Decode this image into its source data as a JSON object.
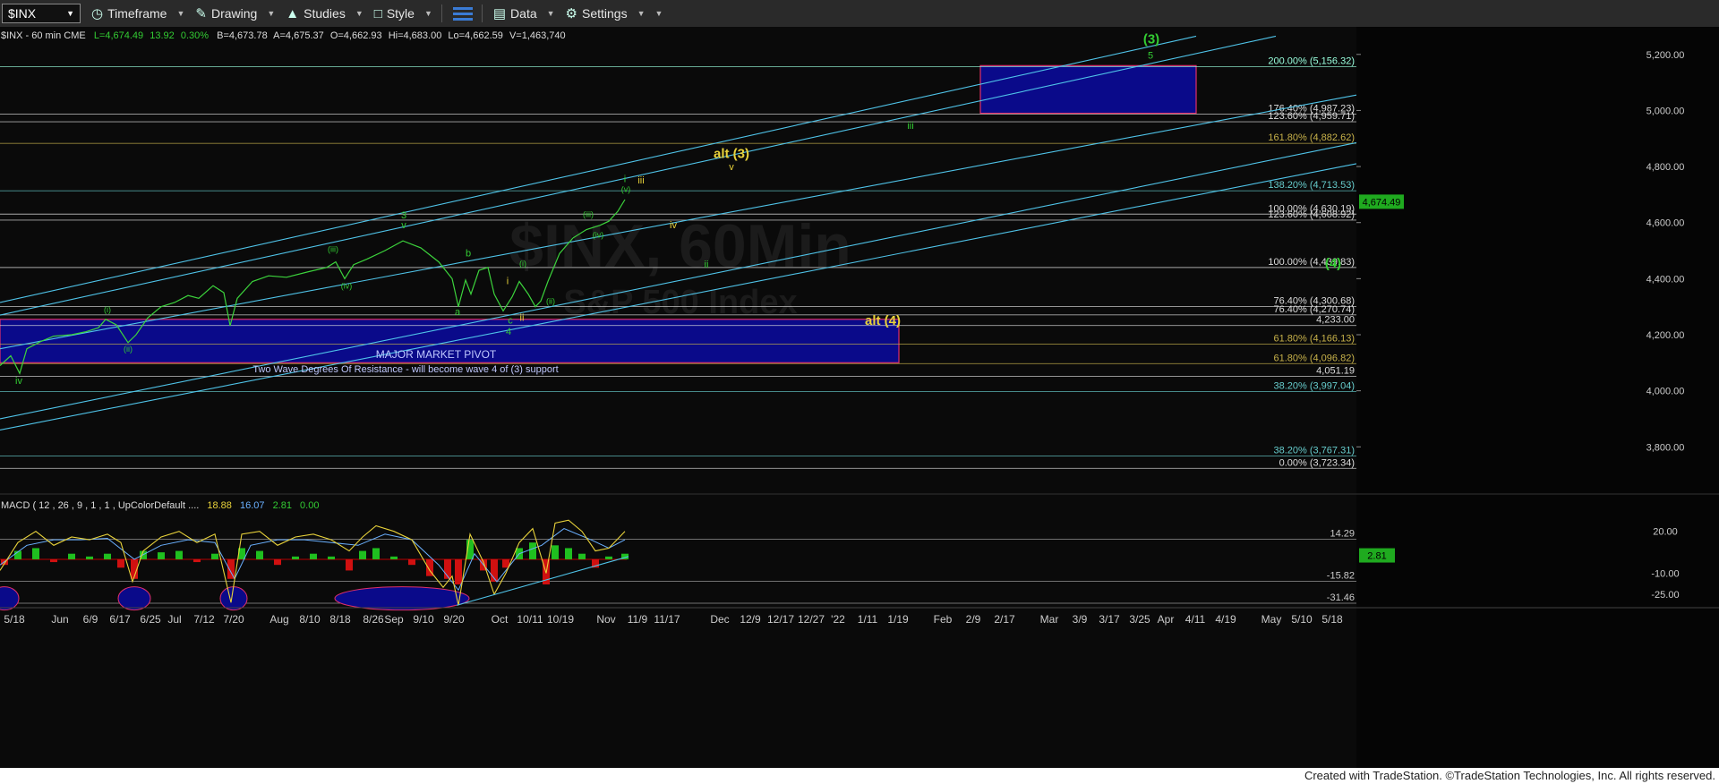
{
  "toolbar": {
    "symbol": "$INX",
    "timeframe": "Timeframe",
    "drawing": "Drawing",
    "studies": "Studies",
    "style": "Style",
    "data": "Data",
    "settings": "Settings"
  },
  "chart_data": {
    "type": "line",
    "header": "$INX - 60 min  CME",
    "quote": {
      "last": "L=4,674.49",
      "change": "13.92",
      "pct": "0.30%",
      "bid": "B=4,673.78",
      "ask": "A=4,675.37",
      "open": "O=4,662.93",
      "high": "Hi=4,683.00",
      "low": "Lo=4,662.59",
      "volume": "V=1,463,740"
    },
    "watermark": "$INX, 60Min",
    "watermark_sub": "S&P 500 Index",
    "price_axis": {
      "ylim": [
        3670,
        5260
      ],
      "ticks": [
        "3,800.00",
        "4,000.00",
        "4,200.00",
        "4,400.00",
        "4,600.00",
        "4,800.00",
        "5,000.00",
        "5,200.00"
      ],
      "last_label": "4,674.49"
    },
    "x_axis_labels": [
      "5/18",
      "Jun",
      "6/9",
      "6/17",
      "6/25",
      "Jul",
      "7/12",
      "7/20",
      "Aug",
      "8/10",
      "8/18",
      "8/26",
      "Sep",
      "9/10",
      "9/20",
      "Oct",
      "10/11",
      "10/19",
      "Nov",
      "11/9",
      "11/17",
      "Dec",
      "12/9",
      "12/17",
      "12/27",
      "'22",
      "1/11",
      "1/19",
      "Feb",
      "2/9",
      "2/17",
      "Mar",
      "3/9",
      "3/17",
      "3/25",
      "Apr",
      "4/11",
      "4/19",
      "May",
      "5/10",
      "5/18"
    ],
    "levels": [
      {
        "price": 5156.32,
        "label": "200.00% (5,156.32)",
        "color": "#9fd"
      },
      {
        "price": 4987.23,
        "label": "176.40% (4,987.23)",
        "color": "#ddd"
      },
      {
        "price": 4959.71,
        "label": "123.60% (4,959.71)",
        "color": "#ddd"
      },
      {
        "price": 4882.62,
        "label": "161.80% (4,882.62)",
        "color": "#c8b24a"
      },
      {
        "price": 4713.53,
        "label": "138.20% (4,713.53)",
        "color": "#6cc"
      },
      {
        "price": 4630.19,
        "label": "100.00% (4,630.19)",
        "color": "#ddd"
      },
      {
        "price": 4608.92,
        "label": "123.60% (4,608.92)",
        "color": "#ddd"
      },
      {
        "price": 4439.83,
        "label": "100.00% (4,439.83)",
        "color": "#ddd"
      },
      {
        "price": 4300.68,
        "label": "76.40% (4,300.68)",
        "color": "#ddd"
      },
      {
        "price": 4270.74,
        "label": "76.40% (4,270.74)",
        "color": "#ddd"
      },
      {
        "price": 4233.0,
        "label": "4,233.00",
        "color": "#ddd"
      },
      {
        "price": 4166.13,
        "label": "61.80% (4,166.13)",
        "color": "#c8b24a"
      },
      {
        "price": 4096.82,
        "label": "61.80% (4,096.82)",
        "color": "#c8b24a"
      },
      {
        "price": 4051.19,
        "label": "4,051.19",
        "color": "#ddd"
      },
      {
        "price": 3997.04,
        "label": "38.20% (3,997.04)",
        "color": "#6cc"
      },
      {
        "price": 3767.31,
        "label": "38.20% (3,767.31)",
        "color": "#6cc"
      },
      {
        "price": 3723.34,
        "label": "0.00% (3,723.34)",
        "color": "#ddd"
      }
    ],
    "zones": [
      {
        "name": "target-zone",
        "x0": 1095,
        "x1": 1336,
        "p0": 4990,
        "p1": 5160,
        "border": "#e0306a"
      },
      {
        "name": "major-pivot-zone",
        "x0": 0,
        "x1": 1004,
        "p0": 4100,
        "p1": 4255,
        "border": "#e0306a"
      }
    ],
    "pivot_title": "MAJOR MARKET PIVOT",
    "pivot_sub": "Two Wave Degrees Of Resistance - will become wave 4 of (3) support",
    "price_path": [
      [
        0,
        4090
      ],
      [
        12,
        4125
      ],
      [
        22,
        4062
      ],
      [
        30,
        4150
      ],
      [
        45,
        4175
      ],
      [
        60,
        4195
      ],
      [
        80,
        4200
      ],
      [
        95,
        4210
      ],
      [
        110,
        4225
      ],
      [
        118,
        4255
      ],
      [
        130,
        4235
      ],
      [
        143,
        4172
      ],
      [
        152,
        4200
      ],
      [
        165,
        4260
      ],
      [
        180,
        4300
      ],
      [
        195,
        4315
      ],
      [
        210,
        4340
      ],
      [
        222,
        4330
      ],
      [
        238,
        4375
      ],
      [
        250,
        4350
      ],
      [
        257,
        4232
      ],
      [
        265,
        4330
      ],
      [
        282,
        4390
      ],
      [
        300,
        4410
      ],
      [
        320,
        4405
      ],
      [
        345,
        4425
      ],
      [
        365,
        4440
      ],
      [
        375,
        4460
      ],
      [
        385,
        4400
      ],
      [
        395,
        4450
      ],
      [
        410,
        4470
      ],
      [
        430,
        4500
      ],
      [
        450,
        4535
      ],
      [
        470,
        4510
      ],
      [
        490,
        4460
      ],
      [
        505,
        4400
      ],
      [
        512,
        4300
      ],
      [
        520,
        4395
      ],
      [
        526,
        4345
      ],
      [
        535,
        4430
      ],
      [
        545,
        4440
      ],
      [
        552,
        4345
      ],
      [
        562,
        4285
      ],
      [
        572,
        4335
      ],
      [
        580,
        4390
      ],
      [
        590,
        4345
      ],
      [
        598,
        4300
      ],
      [
        604,
        4320
      ],
      [
        612,
        4390
      ],
      [
        625,
        4490
      ],
      [
        640,
        4545
      ],
      [
        655,
        4575
      ],
      [
        670,
        4590
      ],
      [
        680,
        4605
      ],
      [
        690,
        4640
      ],
      [
        698,
        4682
      ]
    ],
    "channels": [
      {
        "pts": [
          [
            0,
            4315
          ],
          [
            1336,
            5265
          ]
        ]
      },
      {
        "pts": [
          [
            0,
            4270
          ],
          [
            1425,
            5265
          ]
        ]
      },
      {
        "pts": [
          [
            0,
            4150
          ],
          [
            1515,
            5055
          ]
        ]
      },
      {
        "pts": [
          [
            0,
            3900
          ],
          [
            1515,
            4885
          ]
        ]
      },
      {
        "pts": [
          [
            0,
            3860
          ],
          [
            1515,
            4810
          ]
        ]
      }
    ],
    "wave_labels": [
      {
        "t": "(3)",
        "x": 1286,
        "p": 5240,
        "c": "#3c3",
        "s": 15
      },
      {
        "t": "5",
        "x": 1285,
        "p": 5185,
        "c": "#3c3",
        "s": 11
      },
      {
        "t": "iii",
        "x": 1017,
        "p": 4935,
        "c": "#3c3",
        "s": 11
      },
      {
        "t": "alt (3)",
        "x": 817,
        "p": 4830,
        "c": "#e8d23a",
        "s": 15
      },
      {
        "t": "v",
        "x": 817,
        "p": 4788,
        "c": "#e8d23a",
        "s": 11
      },
      {
        "t": "iv",
        "x": 752,
        "p": 4580,
        "c": "#e8d23a",
        "s": 11
      },
      {
        "t": "ii",
        "x": 789,
        "p": 4440,
        "c": "#3c3",
        "s": 11
      },
      {
        "t": "(4)",
        "x": 1489,
        "p": 4440,
        "c": "#3c3",
        "s": 15
      },
      {
        "t": "alt (4)",
        "x": 986,
        "p": 4235,
        "c": "#e8d23a",
        "s": 15
      },
      {
        "t": "i",
        "x": 698,
        "p": 4745,
        "c": "#3c3",
        "s": 11
      },
      {
        "t": "iii",
        "x": 716,
        "p": 4740,
        "c": "#e8d23a",
        "s": 11
      },
      {
        "t": "(v)",
        "x": 699,
        "p": 4710,
        "c": "#3c3",
        "s": 9
      },
      {
        "t": "(iii)",
        "x": 657,
        "p": 4620,
        "c": "#3c3",
        "s": 9
      },
      {
        "t": "(iv)",
        "x": 668,
        "p": 4547,
        "c": "#3c3",
        "s": 9
      },
      {
        "t": "3",
        "x": 451,
        "p": 4615,
        "c": "#3c3",
        "s": 11
      },
      {
        "t": "v",
        "x": 451,
        "p": 4580,
        "c": "#3c3",
        "s": 11
      },
      {
        "t": "(iii)",
        "x": 372,
        "p": 4495,
        "c": "#3c3",
        "s": 9
      },
      {
        "t": "(iv)",
        "x": 387,
        "p": 4365,
        "c": "#3c3",
        "s": 9
      },
      {
        "t": "b",
        "x": 523,
        "p": 4480,
        "c": "#3c3",
        "s": 11
      },
      {
        "t": "a",
        "x": 511,
        "p": 4270,
        "c": "#3c3",
        "s": 11
      },
      {
        "t": "(i)",
        "x": 584,
        "p": 4445,
        "c": "#3c3",
        "s": 9
      },
      {
        "t": "i",
        "x": 567,
        "p": 4380,
        "c": "#e8d23a",
        "s": 11
      },
      {
        "t": "c",
        "x": 570,
        "p": 4240,
        "c": "#3c3",
        "s": 11
      },
      {
        "t": "4",
        "x": 568,
        "p": 4200,
        "c": "#3c3",
        "s": 11
      },
      {
        "t": "ii",
        "x": 583,
        "p": 4250,
        "c": "#e8d23a",
        "s": 11
      },
      {
        "t": "(ii)",
        "x": 615,
        "p": 4310,
        "c": "#3c3",
        "s": 9
      },
      {
        "t": "(i)",
        "x": 120,
        "p": 4280,
        "c": "#3c3",
        "s": 9
      },
      {
        "t": "(ii)",
        "x": 143,
        "p": 4140,
        "c": "#3c3",
        "s": 9
      },
      {
        "t": "iv",
        "x": 21,
        "p": 4025,
        "c": "#3c3",
        "s": 11
      }
    ],
    "macd": {
      "label": "MACD ( 12 , 26 , 9 , 1 , 1 , UpColorDefault ....",
      "v1": "18.88",
      "v2": "16.07",
      "v3": "2.81",
      "v4": "0.00",
      "ylim": [
        -34,
        32
      ],
      "axis": [
        "20.00",
        "-10.00",
        "-25.00"
      ],
      "levels": [
        {
          "v": 14.29,
          "label": "14.29"
        },
        {
          "v": -15.82,
          "label": "-15.82"
        },
        {
          "v": -31.46,
          "label": "-31.46"
        }
      ],
      "last": "2.81",
      "macd_line": [
        [
          0,
          -8
        ],
        [
          20,
          12
        ],
        [
          40,
          20
        ],
        [
          60,
          10
        ],
        [
          80,
          16
        ],
        [
          100,
          14
        ],
        [
          120,
          18
        ],
        [
          135,
          12
        ],
        [
          148,
          -16
        ],
        [
          160,
          6
        ],
        [
          180,
          16
        ],
        [
          200,
          20
        ],
        [
          220,
          12
        ],
        [
          240,
          18
        ],
        [
          258,
          -31
        ],
        [
          270,
          18
        ],
        [
          290,
          20
        ],
        [
          310,
          10
        ],
        [
          330,
          16
        ],
        [
          350,
          18
        ],
        [
          370,
          14
        ],
        [
          390,
          6
        ],
        [
          405,
          16
        ],
        [
          420,
          24
        ],
        [
          440,
          20
        ],
        [
          460,
          14
        ],
        [
          480,
          -8
        ],
        [
          495,
          -20
        ],
        [
          505,
          -12
        ],
        [
          512,
          -33
        ],
        [
          525,
          18
        ],
        [
          540,
          -2
        ],
        [
          552,
          -25
        ],
        [
          565,
          -10
        ],
        [
          580,
          12
        ],
        [
          595,
          22
        ],
        [
          610,
          -10
        ],
        [
          620,
          26
        ],
        [
          635,
          28
        ],
        [
          650,
          20
        ],
        [
          665,
          6
        ],
        [
          680,
          8
        ],
        [
          698,
          20
        ]
      ],
      "signal_line": [
        [
          0,
          -4
        ],
        [
          30,
          10
        ],
        [
          60,
          14
        ],
        [
          90,
          14
        ],
        [
          120,
          15
        ],
        [
          150,
          0
        ],
        [
          180,
          10
        ],
        [
          210,
          14
        ],
        [
          240,
          12
        ],
        [
          262,
          -14
        ],
        [
          280,
          10
        ],
        [
          310,
          14
        ],
        [
          340,
          14
        ],
        [
          370,
          12
        ],
        [
          400,
          10
        ],
        [
          430,
          18
        ],
        [
          460,
          14
        ],
        [
          490,
          -4
        ],
        [
          512,
          -22
        ],
        [
          530,
          4
        ],
        [
          555,
          -16
        ],
        [
          580,
          4
        ],
        [
          605,
          10
        ],
        [
          630,
          22
        ],
        [
          660,
          14
        ],
        [
          680,
          8
        ],
        [
          698,
          14
        ]
      ],
      "hist": [
        [
          5,
          -4
        ],
        [
          20,
          6
        ],
        [
          40,
          8
        ],
        [
          60,
          -2
        ],
        [
          80,
          4
        ],
        [
          100,
          2
        ],
        [
          120,
          4
        ],
        [
          135,
          -6
        ],
        [
          150,
          -14
        ],
        [
          160,
          6
        ],
        [
          180,
          5
        ],
        [
          200,
          6
        ],
        [
          220,
          -2
        ],
        [
          240,
          4
        ],
        [
          258,
          -14
        ],
        [
          270,
          8
        ],
        [
          290,
          6
        ],
        [
          310,
          -4
        ],
        [
          330,
          2
        ],
        [
          350,
          4
        ],
        [
          370,
          2
        ],
        [
          390,
          -8
        ],
        [
          405,
          6
        ],
        [
          420,
          8
        ],
        [
          440,
          2
        ],
        [
          460,
          -4
        ],
        [
          480,
          -12
        ],
        [
          500,
          -14
        ],
        [
          512,
          -18
        ],
        [
          525,
          14
        ],
        [
          540,
          -8
        ],
        [
          552,
          -16
        ],
        [
          565,
          -6
        ],
        [
          580,
          8
        ],
        [
          595,
          12
        ],
        [
          610,
          -18
        ],
        [
          620,
          10
        ],
        [
          635,
          8
        ],
        [
          650,
          4
        ],
        [
          665,
          -6
        ],
        [
          680,
          2
        ],
        [
          698,
          4
        ]
      ],
      "support_line": [
        [
          510,
          -33
        ],
        [
          702,
          2
        ]
      ],
      "ellipses": [
        {
          "cx": 5,
          "rx": 16
        },
        {
          "cx": 150,
          "rx": 18
        },
        {
          "cx": 261,
          "rx": 15
        },
        {
          "cx": 449,
          "rx": 75
        }
      ],
      "hline_zero": 0
    }
  },
  "footer": "Created with TradeStation. ©TradeStation Technologies, Inc. All rights reserved."
}
